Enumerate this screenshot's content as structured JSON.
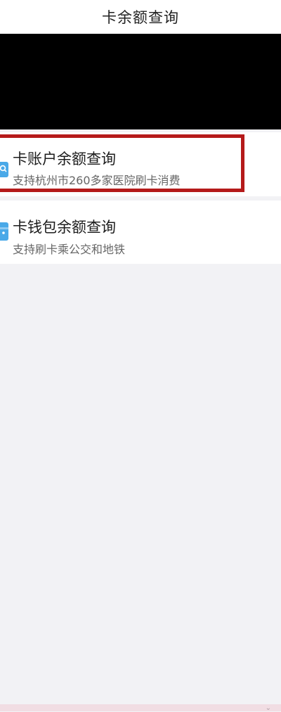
{
  "header": {
    "title": "卡余额查询"
  },
  "cards": [
    {
      "title": "卡账户余额查询",
      "subtitle": "支持杭州市260多家医院刷卡消费",
      "icon": "search-card-icon"
    },
    {
      "title": "卡钱包余额查询",
      "subtitle": "支持刷卡乘公交和地铁",
      "icon": "wallet-icon"
    }
  ],
  "colors": {
    "background": "#f2f2f5",
    "highlight_border": "#b51a1a",
    "icon_blue": "#4aa9e8"
  }
}
